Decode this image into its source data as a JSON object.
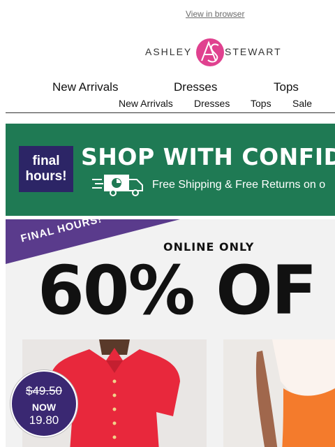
{
  "preheader": {
    "view_in_browser": "View in browser"
  },
  "logo": {
    "word_left": "ASHLEY",
    "word_right": "STEWART"
  },
  "nav_primary": [
    {
      "label": "New Arrivals"
    },
    {
      "label": "Dresses"
    },
    {
      "label": "Tops"
    }
  ],
  "nav_secondary": [
    {
      "label": "New Arrivals"
    },
    {
      "label": "Dresses"
    },
    {
      "label": "Tops"
    },
    {
      "label": "Sale"
    }
  ],
  "banner": {
    "badge": "final hours!",
    "headline": "SHOP WITH CONFID",
    "subline": "Free Shipping & Free Returns on o",
    "icon": "delivery-truck-icon",
    "colors": {
      "background": "#1f7a54",
      "badge": "#2c2566"
    }
  },
  "hero": {
    "ribbon": "FINAL HOURS!",
    "online_only": "ONLINE ONLY",
    "discount": "60% OF",
    "colors": {
      "ribbon": "#5a3b8c",
      "background": "#f2f2f2"
    }
  },
  "price_badge": {
    "old_price": "$49.50",
    "now_label": "NOW",
    "new_price": "19.80",
    "color": "#3a2872"
  }
}
